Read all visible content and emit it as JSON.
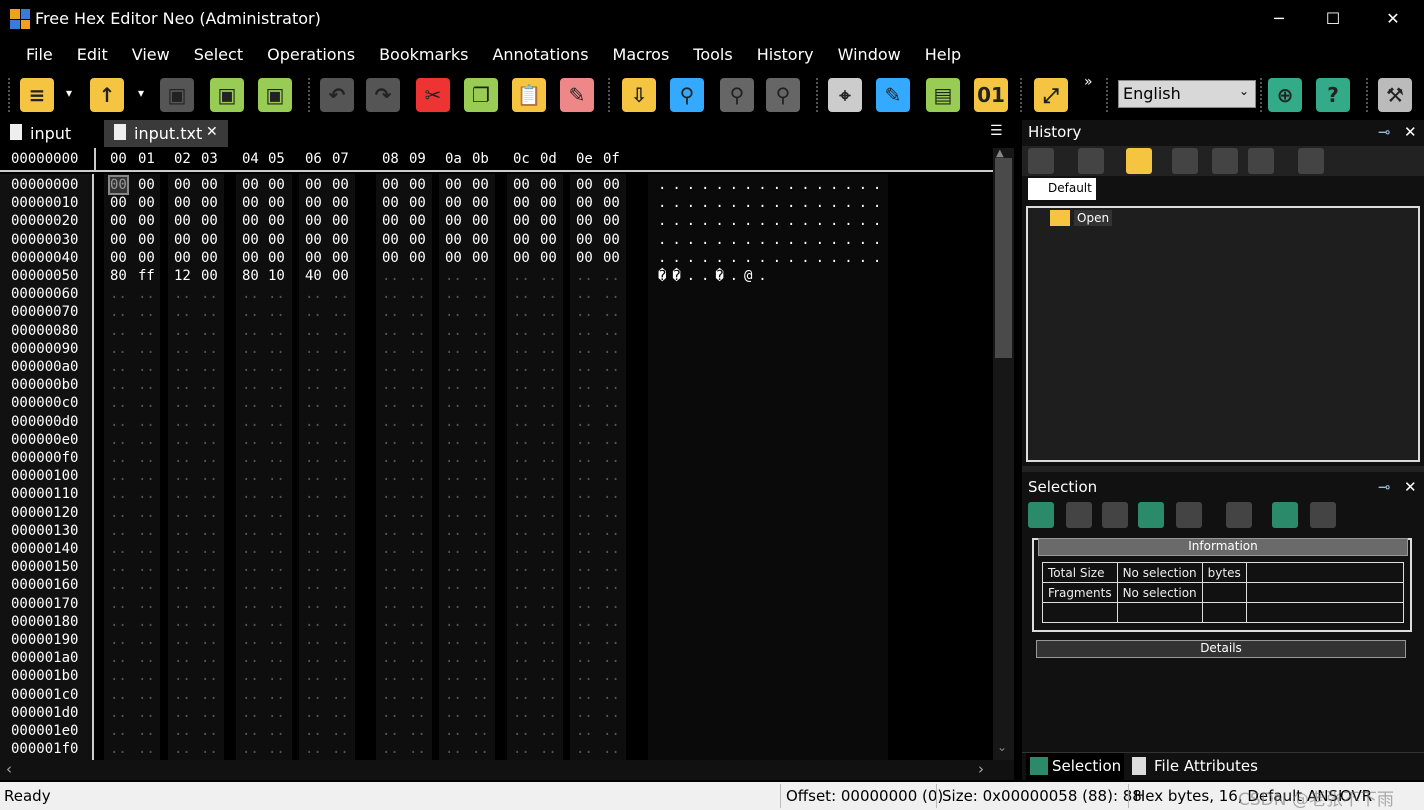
{
  "window": {
    "title": "Free Hex Editor Neo (Administrator)",
    "minimize": "─",
    "maximize": "☐",
    "close": "✕"
  },
  "menu": [
    "File",
    "Edit",
    "View",
    "Select",
    "Operations",
    "Bookmarks",
    "Annotations",
    "Macros",
    "Tools",
    "History",
    "Window",
    "Help"
  ],
  "toolbar": {
    "language": "English",
    "overflow": "»",
    "icons": [
      "new-file-icon",
      "open-file-icon",
      "save-icon",
      "save-as-icon",
      "save-all-icon",
      "undo-icon",
      "redo-icon",
      "cut-icon",
      "copy-icon",
      "paste-icon",
      "clear-icon",
      "export-icon",
      "find-icon",
      "find-next-icon",
      "find-previous-icon",
      "bookmark-icon",
      "annotate-icon",
      "patterns-icon",
      "binary-icon",
      "fullscreen-icon",
      "web-update-icon",
      "web-help-icon",
      "settings-icon"
    ]
  },
  "tabs": [
    {
      "label": "input"
    },
    {
      "label": "input.txt",
      "close": "✕",
      "active": true
    }
  ],
  "hex": {
    "header_offset": "00000000",
    "columns": [
      "00",
      "01",
      "02",
      "03",
      "04",
      "05",
      "06",
      "07",
      "08",
      "09",
      "0a",
      "0b",
      "0c",
      "0d",
      "0e",
      "0f"
    ],
    "offsets": [
      "00000000",
      "00000010",
      "00000020",
      "00000030",
      "00000040",
      "00000050",
      "00000060",
      "00000070",
      "00000080",
      "00000090",
      "000000a0",
      "000000b0",
      "000000c0",
      "000000d0",
      "000000e0",
      "000000f0",
      "00000100",
      "00000110",
      "00000120",
      "00000130",
      "00000140",
      "00000150",
      "00000160",
      "00000170",
      "00000180",
      "00000190",
      "000001a0",
      "000001b0",
      "000001c0",
      "000001d0",
      "000001e0",
      "000001f0"
    ],
    "rows": [
      [
        "00",
        "00",
        "00",
        "00",
        "00",
        "00",
        "00",
        "00",
        "00",
        "00",
        "00",
        "00",
        "00",
        "00",
        "00",
        "00"
      ],
      [
        "00",
        "00",
        "00",
        "00",
        "00",
        "00",
        "00",
        "00",
        "00",
        "00",
        "00",
        "00",
        "00",
        "00",
        "00",
        "00"
      ],
      [
        "00",
        "00",
        "00",
        "00",
        "00",
        "00",
        "00",
        "00",
        "00",
        "00",
        "00",
        "00",
        "00",
        "00",
        "00",
        "00"
      ],
      [
        "00",
        "00",
        "00",
        "00",
        "00",
        "00",
        "00",
        "00",
        "00",
        "00",
        "00",
        "00",
        "00",
        "00",
        "00",
        "00"
      ],
      [
        "00",
        "00",
        "00",
        "00",
        "00",
        "00",
        "00",
        "00",
        "00",
        "00",
        "00",
        "00",
        "00",
        "00",
        "00",
        "00"
      ],
      [
        "80",
        "ff",
        "12",
        "00",
        "80",
        "10",
        "40",
        "00"
      ]
    ],
    "text": [
      "................",
      "................",
      "................",
      "................",
      "................",
      "��..�.@."
    ],
    "empty_cell": "..",
    "cursor_color": "#5a5a5a"
  },
  "history": {
    "title": "History",
    "tab": "Default",
    "items": [
      "Open"
    ]
  },
  "selection": {
    "title": "Selection",
    "information": "Information",
    "details": "Details",
    "table": [
      [
        "Total Size",
        "No selection",
        "bytes",
        ""
      ],
      [
        "Fragments",
        "No selection",
        "",
        ""
      ],
      [
        "",
        "",
        "",
        ""
      ]
    ]
  },
  "bottom_tabs": [
    "Selection",
    "File Attributes"
  ],
  "status": {
    "ready": "Ready",
    "offset": "Offset: 00000000 (0)",
    "size": "Size: 0x00000058 (88): 88",
    "mode": "Hex bytes, 16, Default ANSI",
    "ovr": "OVR"
  },
  "watermark": "CSDN @老张不下雨"
}
